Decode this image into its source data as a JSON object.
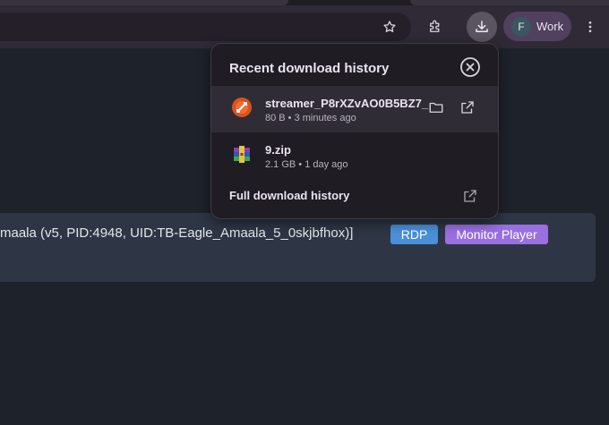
{
  "browser": {
    "profile": {
      "initial": "F",
      "label": "Work"
    },
    "icons": {
      "bookmark": "star-icon",
      "extensions": "puzzle-icon",
      "downloads": "download-icon",
      "menu": "kebab-menu-icon"
    }
  },
  "downloads_panel": {
    "title": "Recent download history",
    "items": [
      {
        "name": "streamer_P8rXZvAO0B5BZ7_",
        "meta": "80 B • 3 minutes ago",
        "icon": "remote-desktop-icon"
      },
      {
        "name": "9.zip",
        "meta": "2.1 GB • 1 day ago",
        "icon": "archive-icon"
      }
    ],
    "footer_link": "Full download history"
  },
  "page": {
    "session_text": "maala (v5, PID:4948, UID:TB-Eagle_Amaala_5_0skjbfhox)]",
    "buttons": {
      "rdp": "RDP",
      "monitor": "Monitor Player"
    },
    "colors": {
      "rdp": "#4a90d9",
      "monitor": "#9a6fe0"
    }
  }
}
